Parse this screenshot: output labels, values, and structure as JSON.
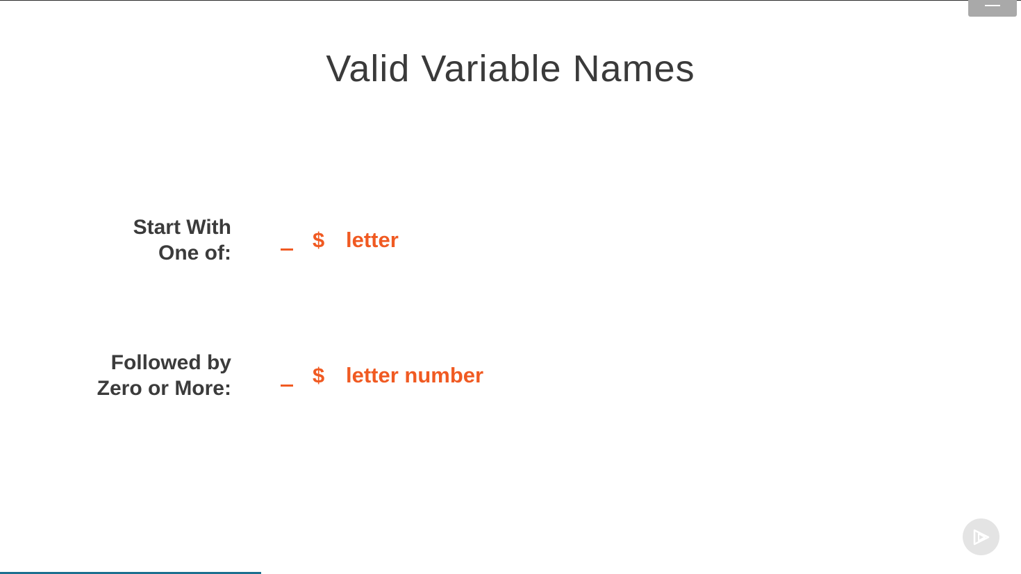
{
  "slide": {
    "title": "Valid Variable Names"
  },
  "rows": [
    {
      "label_line1": "Start With",
      "label_line2": "One of:",
      "underscore": "_",
      "dollar": "$",
      "rest": "letter"
    },
    {
      "label_line1": "Followed by",
      "label_line2": "Zero or More:",
      "underscore": "_",
      "dollar": "$",
      "rest": "letter number"
    }
  ],
  "colors": {
    "accent": "#f05a22",
    "label": "#3b3b3b",
    "title": "#3a3a3a",
    "progress": "#1b6f8f"
  },
  "icons": {
    "menu": "menu-icon",
    "player": "play-icon"
  }
}
